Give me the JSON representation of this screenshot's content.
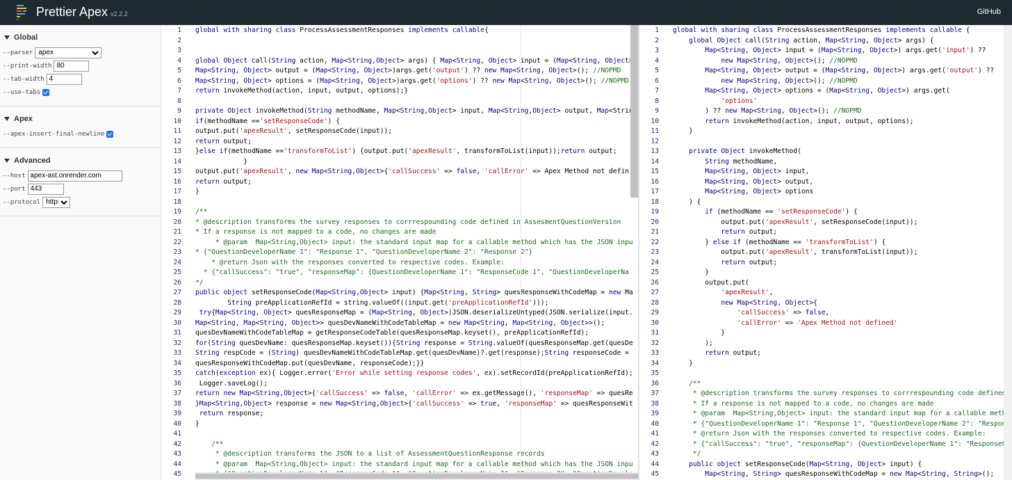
{
  "header": {
    "title": "Prettier Apex",
    "version": "v2.2.2",
    "github_label": "GitHub",
    "background": "#1f2a30"
  },
  "sidebar": {
    "global": {
      "title": "Global",
      "parser_label": "--parser",
      "parser_value": "apex",
      "print_width_label": "--print-width",
      "print_width_value": "80",
      "tab_width_label": "--tab-width",
      "tab_width_value": "4",
      "use_tabs_label": "--use-tabs",
      "use_tabs_checked": true
    },
    "apex": {
      "title": "Apex",
      "insert_final_newline_label": "--apex-insert-final-newline",
      "insert_final_newline_checked": true
    },
    "advanced": {
      "title": "Advanced",
      "host_label": "--host",
      "host_value": "apex-ast.onrender.com",
      "port_label": "--port",
      "port_value": "443",
      "protocol_label": "--protocol",
      "protocol_value": "https"
    }
  },
  "input_code": [
    "global with sharing class ProcessAssessmentResponses implements callable{",
    "",
    "",
    "global Object call(String action, Map<String,Object> args) { Map<String, Object> input = (Map<String, Object>",
    "Map<String, Object> output = (Map<String, Object>)args.get('output') ?? new Map<String, Object>(); //NOPMD",
    "Map<String, Object> options = (Map<String, Object>)args.get('options') ?? new Map<String, Object>(); //NOPMD",
    "return invokeMethod(action, input, output, options);}",
    "",
    "private Object invokeMethod(String methodName, Map<String,Object> input, Map<String,Object> output, Map<Strin",
    "if(methodName =='setResponseCode') {",
    "output.put('apexResult', setResponseCode(input));",
    "return output;",
    "}else if(methodName =='transformToList') {output.put('apexResult', transformToList(input));return output;",
    "            }",
    "output.put('apexResult', new Map<String,Object>{'callSuccess' => false, 'callError' => 'Apex Method not defin",
    "return output;",
    "}",
    "",
    "/**",
    "* @description transforms the survey responses to corrrespounding code defined in AssesmentQuestionVersion",
    "* If a response is not mapped to a code, no changes are made",
    "     * @param  Map<String,Object> input: the standard input map for a callable method which has the JSON inpu",
    "* {\"QuestionDeveloperName 1\": \"Response 1\", \"QuestionDeveloperName 2\": \"Response 2\"}",
    "    * @return Json with the responses converted to respective codes. Example:",
    "  * {\"callSuccess\": \"true\", \"responseMap\": {QuestionDeveloperName 1\": \"ResponseCode 1\", \"QuestionDeveloperNa",
    "*/",
    "public object setResponseCode(Map<String,Object> input) {Map<String, String> quesResponseWithCodeMap = new Ma",
    "        String preApplicationRefId = string.valueOf((input.get('preApplicationRefId')));",
    " try{Map<String, Object> quesResponseMap = (Map<String, Object>)JSON.deserializeUntyped(JSON.serialize(input.",
    "Map<String, Map<String, Object>> quesDevNameWithCodeTableMap = new Map<String, Map<String, Object>>();",
    "quesDevNameWithCodeTableMap = getResponseCodeTable(quesResponseMap.keyset(), preApplicationRefId);",
    "for(String quesDevName: quesResponseMap.keyset()){String response = String.valueOf(quesResponseMap.get(quesDe",
    "String respCode = (String) quesDevNameWithCodeTableMap.get(quesDevName)?.get(response);String responseCode =",
    "quesResponseWithCodeMap.put(quesDevName, responseCode);}}",
    "catch(exception ex){ Logger.error('Error while setting response codes', ex).setRecordId(preApplicationRefId);",
    " Logger.saveLog();",
    "return new Map<String,Object>{'callSuccess' => false, 'callError' => ex.getMessage(), 'responseMap' => quesRe",
    "}Map<String,Object> response = new Map<String,Object>{'callSuccess' => true, 'responseMap' => quesResponseWit",
    " return response;",
    "}",
    "",
    "    /**",
    "     * @description transforms the JSON to a list of AssessmentQuestionResponse records",
    "     * @param  Map<String,Object> input: the standard input map for a callable method which has the JSON inpu",
    "     * {\"QuestionDeveloperName 1\": \"ResponseCode 1\", \"QuestionDeveloperName 2\": \"Response 2\", \"QuestionDevelo"
  ],
  "output_code": [
    "global with sharing class ProcessAssessmentResponses implements callable {",
    "    global Object call(String action, Map<String, Object> args) {",
    "        Map<String, Object> input = (Map<String, Object>) args.get('input') ??",
    "            new Map<String, Object>(); //NOPMD",
    "        Map<String, Object> output = (Map<String, Object>) args.get('output') ??",
    "            new Map<String, Object>(); //NOPMD",
    "        Map<String, Object> options = (Map<String, Object>) args.get(",
    "            'options'",
    "        ) ?? new Map<String, Object>(); //NOPMD",
    "        return invokeMethod(action, input, output, options);",
    "    }",
    "",
    "    private Object invokeMethod(",
    "        String methodName,",
    "        Map<String, Object> input,",
    "        Map<String, Object> output,",
    "        Map<String, Object> options",
    "    ) {",
    "        if (methodName == 'setResponseCode') {",
    "            output.put('apexResult', setResponseCode(input));",
    "            return output;",
    "        } else if (methodName == 'transformToList') {",
    "            output.put('apexResult', transformToList(input));",
    "            return output;",
    "        }",
    "        output.put(",
    "            'apexResult',",
    "            new Map<String, Object>{",
    "                'callSuccess' => false,",
    "                'callError' => 'Apex Method not defined'",
    "            }",
    "        );",
    "        return output;",
    "    }",
    "",
    "    /**",
    "     * @description transforms the survey responses to corrrespounding code defined",
    "     * If a response is not mapped to a code, no changes are made",
    "     * @param  Map<String,Object> input: the standard input map for a callable metho",
    "     * {\"QuestionDeveloperName 1\": \"Response 1\", \"QuestionDeveloperName 2\": \"Respon",
    "     * @return Json with the responses converted to respective codes. Example:",
    "     * {\"callSuccess\": \"true\", \"responseMap\": {QuestionDeveloperName 1\": \"ResponseCo",
    "     */",
    "    public object setResponseCode(Map<String, Object> input) {",
    "        Map<String, String> quesResponseWithCodeMap = new Map<String, String>();"
  ]
}
